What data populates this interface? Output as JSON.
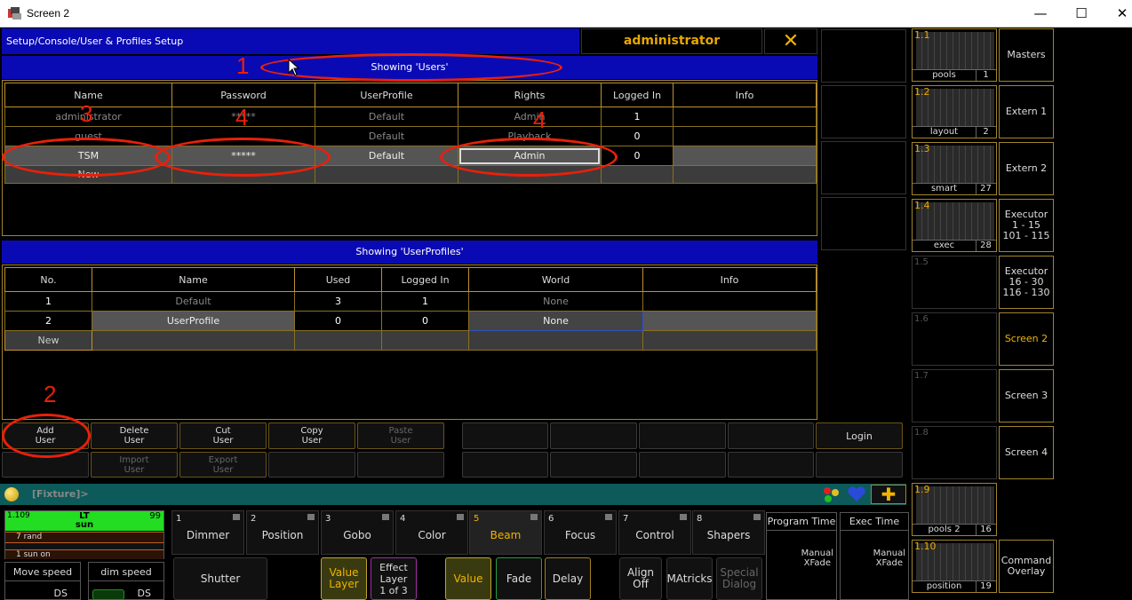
{
  "window": {
    "title": "Screen 2",
    "minimize": "—",
    "maximize": "☐",
    "close": "✕"
  },
  "header": {
    "path": "Setup/Console/User & Profiles Setup",
    "user": "administrator",
    "close_glyph": "✕"
  },
  "users": {
    "bar": "Showing 'Users'",
    "columns": [
      "Name",
      "Password",
      "UserProfile",
      "Rights",
      "Logged In",
      "Info"
    ],
    "rows": [
      {
        "name": "administrator",
        "password": "*****",
        "profile": "Default",
        "rights": "Admin",
        "logged": "1",
        "info": ""
      },
      {
        "name": "guest",
        "password": "",
        "profile": "Default",
        "rights": "Playback",
        "logged": "0",
        "info": ""
      },
      {
        "name": "TSM",
        "password": "*****",
        "profile": "Default",
        "rights": "Admin",
        "logged": "0",
        "info": ""
      },
      {
        "name": "New",
        "password": "",
        "profile": "",
        "rights": "",
        "logged": "",
        "info": ""
      }
    ]
  },
  "profiles": {
    "bar": "Showing 'UserProfiles'",
    "columns": [
      "No.",
      "Name",
      "Used",
      "Logged In",
      "World",
      "Info"
    ],
    "rows": [
      {
        "no": "1",
        "name": "Default",
        "used": "3",
        "logged": "1",
        "world": "None",
        "info": ""
      },
      {
        "no": "2",
        "name": "UserProfile",
        "used": "0",
        "logged": "0",
        "world": "None",
        "info": ""
      },
      {
        "no": "New",
        "name": "",
        "used": "",
        "logged": "",
        "world": "",
        "info": ""
      }
    ]
  },
  "buttons": {
    "add": "Add\nUser",
    "delete": "Delete\nUser",
    "cut": "Cut\nUser",
    "copy": "Copy\nUser",
    "paste": "Paste\nUser",
    "import": "Import\nUser",
    "export": "Export\nUser",
    "login": "Login"
  },
  "annotations": [
    "1",
    "2",
    "3",
    "4",
    "4"
  ],
  "views": [
    {
      "label": "1.1",
      "name": "pools",
      "num": "1"
    },
    {
      "label": "1.2",
      "name": "layout",
      "num": "2"
    },
    {
      "label": "1.3",
      "name": "smart",
      "num": "27"
    },
    {
      "label": "1.4",
      "name": "exec",
      "num": "28"
    },
    {
      "label": "1.5"
    },
    {
      "label": "1.6"
    },
    {
      "label": "1.7"
    },
    {
      "label": "1.8"
    },
    {
      "label": "1.9",
      "name": "pools 2",
      "num": "16"
    },
    {
      "label": "1.10",
      "name": "position",
      "num": "19"
    }
  ],
  "screens": [
    "Masters",
    "Extern 1",
    "Extern 2",
    "Executor\n1 - 15\n101 - 115",
    "Executor\n16 - 30\n116 - 130",
    "Screen 2",
    "Screen 3",
    "Screen 4",
    "",
    "Command\nOverlay"
  ],
  "command": {
    "text": "[Fixture]>"
  },
  "executor": {
    "id": "1.109",
    "name": "LT",
    "sub": "sun",
    "value": "99",
    "line1": "7 rand",
    "line2": "1 sun on"
  },
  "speeds": {
    "move": "Move speed",
    "dim": "dim speed",
    "ds": "DS"
  },
  "encoders": [
    {
      "n": "1",
      "l": "Dimmer"
    },
    {
      "n": "2",
      "l": "Position"
    },
    {
      "n": "3",
      "l": "Gobo"
    },
    {
      "n": "4",
      "l": "Color"
    },
    {
      "n": "5",
      "l": "Beam"
    },
    {
      "n": "6",
      "l": "Focus"
    },
    {
      "n": "7",
      "l": "Control"
    },
    {
      "n": "8",
      "l": "Shapers"
    }
  ],
  "bottom": {
    "shutter": "Shutter",
    "value_layer": "Value\nLayer",
    "effect_layer": "Effect\nLayer\n1 of 3",
    "value": "Value",
    "fade": "Fade",
    "delay": "Delay",
    "align": "Align\nOff",
    "matricks": "MAtricks",
    "special": "Special\nDialog",
    "program_time": "Program Time",
    "exec_time": "Exec Time",
    "manual_xfade": "Manual\nXFade"
  },
  "colors": {
    "accent": "#f0b400",
    "blue": "#0a0ab4",
    "annotation": "#e8200a",
    "exec_green": "#22dd22"
  }
}
